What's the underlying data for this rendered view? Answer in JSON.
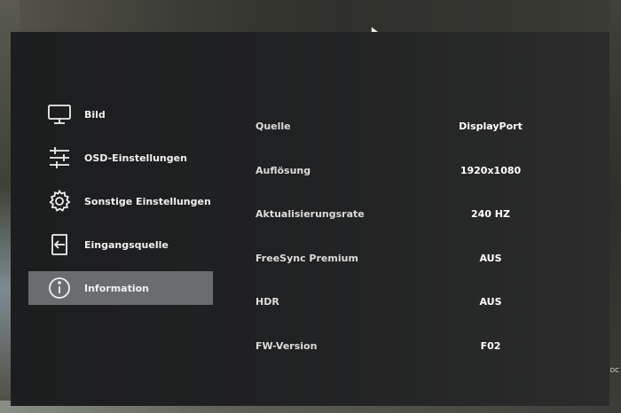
{
  "menu": {
    "items": [
      {
        "label": "Bild",
        "icon": "monitor-icon",
        "active": false
      },
      {
        "label": "OSD-Einstellungen",
        "icon": "sliders-icon",
        "active": false
      },
      {
        "label": "Sonstige Einstellungen",
        "icon": "gear-icon",
        "active": false
      },
      {
        "label": "Eingangsquelle",
        "icon": "input-source-icon",
        "active": false
      },
      {
        "label": "Information",
        "icon": "info-icon",
        "active": true
      }
    ]
  },
  "info": {
    "rows": [
      {
        "label": "Quelle",
        "value": "DisplayPort"
      },
      {
        "label": "Auflösung",
        "value": "1920x1080"
      },
      {
        "label": "Aktualisierungsrate",
        "value": "240 HZ"
      },
      {
        "label": "FreeSync Premium",
        "value": "AUS"
      },
      {
        "label": "HDR",
        "value": "AUS"
      },
      {
        "label": "FW-Version",
        "value": "F02"
      }
    ]
  },
  "edge_text": "DC",
  "colors": {
    "panel_background": "#1f2021",
    "active_item_background": "#6a6d70",
    "text": "#f0f0f0"
  }
}
